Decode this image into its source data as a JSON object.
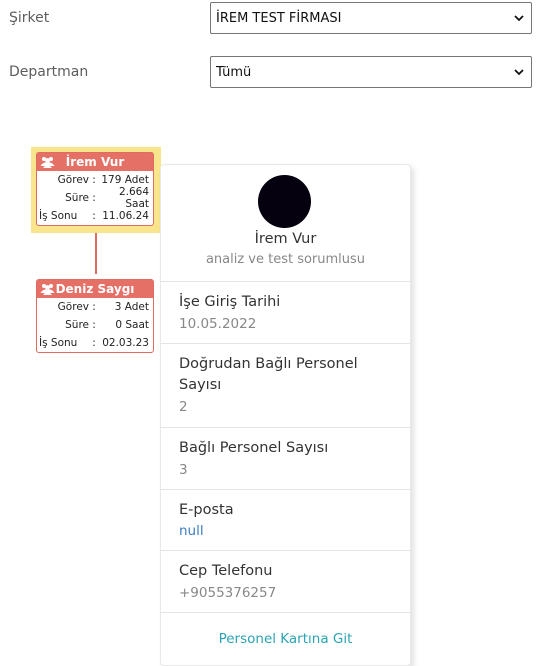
{
  "filters": {
    "company_label": "Şirket",
    "company_value": "İREM TEST FİRMASI",
    "department_label": "Departman",
    "department_value": "Tümü"
  },
  "org_chart": {
    "nodes": [
      {
        "name": "İrem Vur",
        "task_label": "Görev",
        "task_value": "179 Adet",
        "duration_label": "Süre",
        "duration_value": "2.664 Saat",
        "end_label": "İş Sonu",
        "end_value": "11.06.24",
        "highlighted": true
      },
      {
        "name": "Deniz Saygı",
        "task_label": "Görev",
        "task_value": "3 Adet",
        "duration_label": "Süre",
        "duration_value": "0 Saat",
        "end_label": "İş Sonu",
        "end_value": "02.03.23",
        "highlighted": false
      }
    ],
    "separator": ":"
  },
  "profile_card": {
    "name": "İrem Vur",
    "title": "analiz ve test sorumlusu",
    "start_date_label": "İşe Giriş Tarihi",
    "start_date_value": "10.05.2022",
    "direct_reports_label": "Doğrudan Bağlı Personel Sayısı",
    "direct_reports_value": "2",
    "total_reports_label": "Bağlı Personel Sayısı",
    "total_reports_value": "3",
    "email_label": "E-posta",
    "email_value": "null",
    "phone_label": "Cep Telefonu",
    "phone_value": "+9055376257",
    "link_label": "Personel Kartına Git"
  },
  "colors": {
    "node_header": "#e47066",
    "highlight": "#f8e58c",
    "link": "#2aa3b3",
    "email_link": "#3b7cc4"
  },
  "icons": [
    "chevron-down-icon",
    "users-icon"
  ]
}
